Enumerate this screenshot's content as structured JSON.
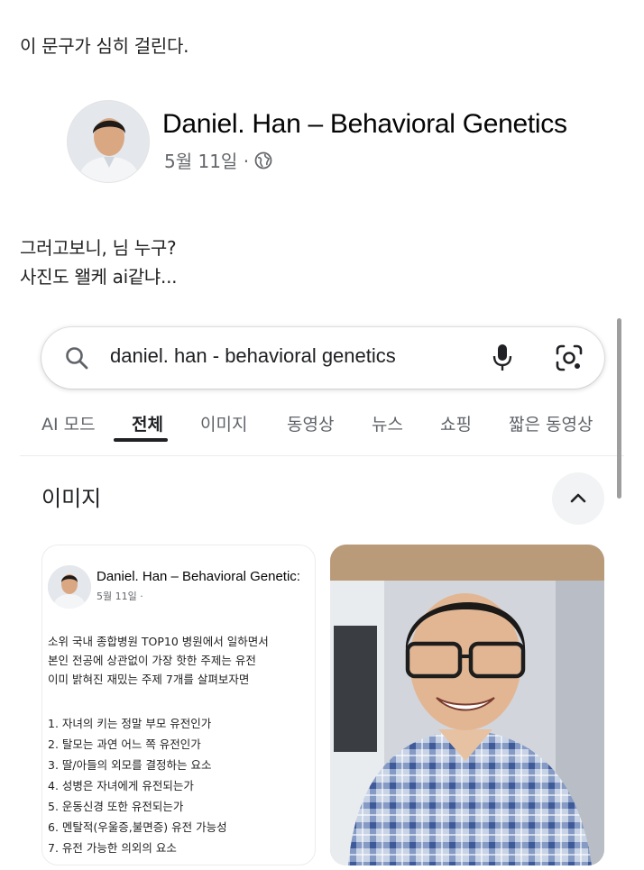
{
  "captions": {
    "line1": "이 문구가 심히 걸린다.",
    "line2": "그러고보니, 님 누구?",
    "line3": "사진도 왤케 ai같냐..."
  },
  "fb_post": {
    "author": "Daniel. Han – Behavioral Genetics",
    "date": "5월 11일 ·",
    "privacy_icon": "globe-icon"
  },
  "search": {
    "query": "daniel. han - behavioral genetics",
    "icons": [
      "search-icon",
      "mic-icon",
      "lens-icon"
    ]
  },
  "tabs": [
    {
      "label": "AI 모드",
      "active": false
    },
    {
      "label": "전체",
      "active": true
    },
    {
      "label": "이미지",
      "active": false
    },
    {
      "label": "동영상",
      "active": false
    },
    {
      "label": "뉴스",
      "active": false
    },
    {
      "label": "쇼핑",
      "active": false
    },
    {
      "label": "짧은 동영상",
      "active": false
    }
  ],
  "images_section": {
    "title": "이미지",
    "collapse_icon": "chevron-up-icon",
    "result1": {
      "author": "Daniel. Han – Behavioral Genetic:",
      "date": "5월 11일 ·",
      "intro": [
        "소위 국내 종합병원 TOP10 병원에서 일하면서",
        "본인 전공에 상관없이 가장 핫한 주제는 유전",
        "이미 밝혀진 재밌는 주제 7개를 살펴보자면"
      ],
      "list": [
        "1. 자녀의 키는 정말 부모 유전인가",
        "2. 탈모는 과연 어느 쪽 유전인가",
        "3. 딸/아들의 외모를 결정하는 요소",
        "4. 성병은 자녀에게 유전되는가",
        "5. 운동신경 또한 유전되는가",
        "6. 멘탈적(우울증,불면증) 유전 가능성",
        "7. 유전 가능한 의외의 요소"
      ]
    }
  },
  "colors": {
    "text_primary": "#202124",
    "text_secondary": "#5f6368",
    "fb_meta": "#65676b"
  }
}
